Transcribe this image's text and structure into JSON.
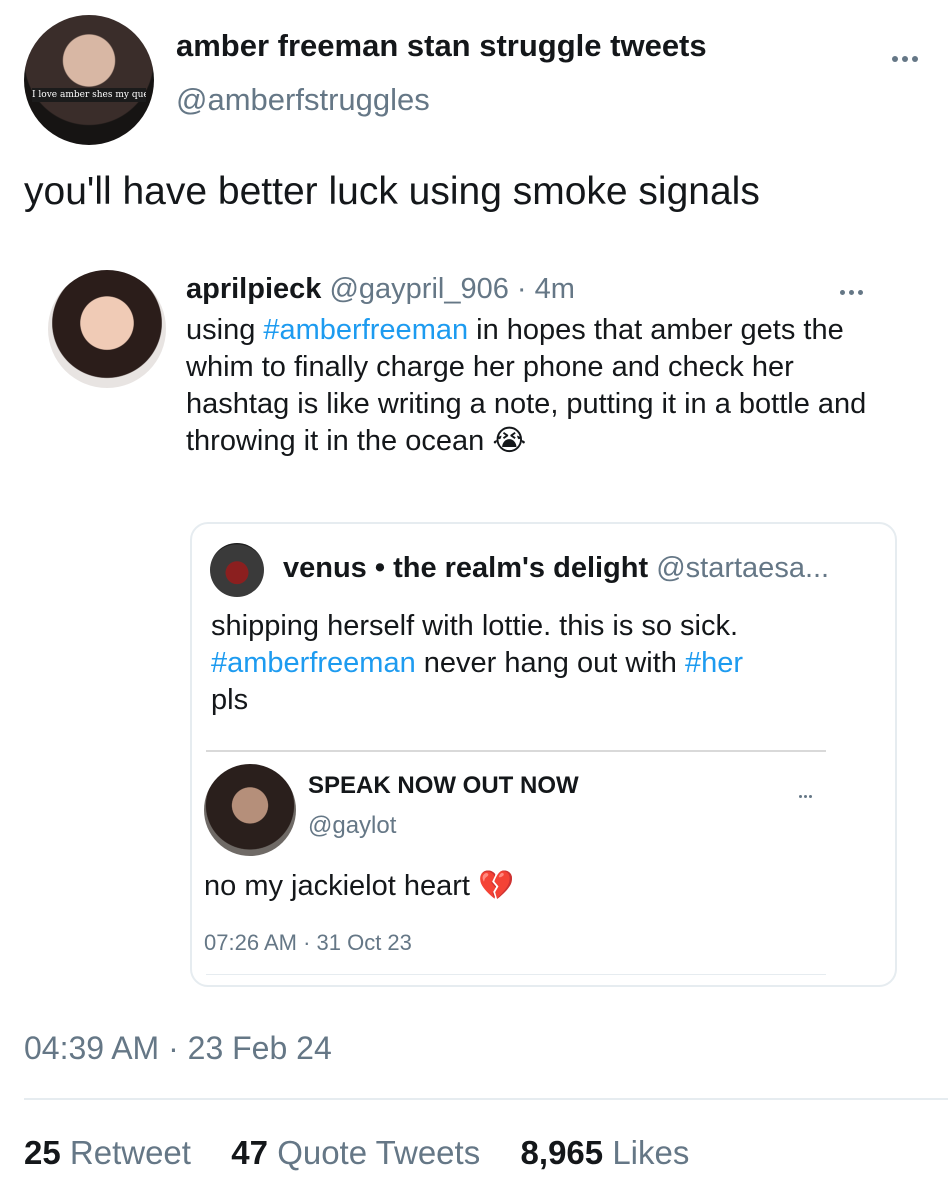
{
  "main_tweet": {
    "display_name": "amber freeman stan struggle tweets",
    "handle": "@amberfstruggles",
    "avatar_caption": "I love amber shes my queer",
    "text": "you'll have better luck using smoke signals",
    "timestamp_time": "04:39 AM",
    "timestamp_sep": "·",
    "timestamp_date": "23 Feb 24"
  },
  "quoted_tweet": {
    "display_name": "aprilpieck",
    "handle": "@gaypril_906",
    "sep": "·",
    "age": "4m",
    "text_parts": [
      "using ",
      "#amberfreeman",
      " in hopes that amber gets the whim to finally charge her phone and check her hashtag is like writing a note, putting it in a bottle and throwing it in the ocean ",
      "😭"
    ]
  },
  "nested_card": {
    "venus_name": "venus • the realm's delight",
    "venus_handle": "@startaesa...",
    "venus_text_1": "shipping herself with lottie. this is so sick.",
    "venus_tag_1": "#amberfreeman",
    "venus_text_2": " never hang out with ",
    "venus_tag_2": "#her",
    "venus_text_3": "pls",
    "reply_name": "SPEAK NOW OUT NOW",
    "reply_handle": "@gaylot",
    "reply_text": "no my jackielot heart ",
    "reply_emoji": "💔",
    "reply_timestamp": "07:26 AM · 31 Oct 23"
  },
  "stats": {
    "retweets_count": "25",
    "retweets_label": "Retweet",
    "quotes_count": "47",
    "quotes_label": "Quote Tweets",
    "likes_count": "8,965",
    "likes_label": "Likes"
  },
  "colors": {
    "link": "#1d9bf0",
    "muted": "#657786",
    "text": "#14171a"
  }
}
